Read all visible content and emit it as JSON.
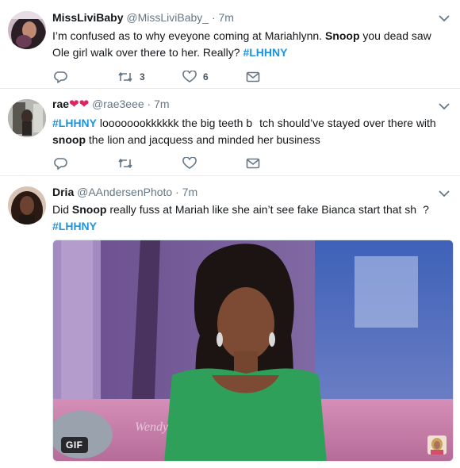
{
  "tweets": [
    {
      "name": "MissLiviBaby",
      "handle": "@MissLiviBaby_",
      "dot": "·",
      "time": "7m",
      "text_parts": [
        "I’m confused as to why eveyone coming at Mariahlynn. ",
        "Snoop",
        " you dead saw Ole girl walk over there to her. Really? ",
        "#LHHNY"
      ],
      "reply_count": "",
      "retweet_count": "3",
      "like_count": "6"
    },
    {
      "name": "rae",
      "hearts": "❤❤",
      "handle": "@rae3eee",
      "dot": "·",
      "time": "7m",
      "text_parts": [
        "#LHHNY",
        " loooooookkkkkk the big teeth b",
        "tch should’ve stayed over there with ",
        "snoop",
        " the lion and jacquess and minded her business"
      ],
      "retweet_count": "",
      "like_count": ""
    },
    {
      "name": "Dria",
      "handle": "@AAndersenPhoto",
      "dot": "·",
      "time": "7m",
      "text_parts": [
        "Did ",
        "Snoop",
        " really fuss at Mariah like she ain’t see fake Bianca start that sh",
        "?",
        "#LHHNY"
      ],
      "media": {
        "badge": "GIF",
        "watermark": "Wendy"
      }
    }
  ],
  "icons": {
    "reply": "reply-icon",
    "retweet": "retweet-icon",
    "like": "heart-icon",
    "dm": "envelope-icon",
    "caret": "chevron-down-icon"
  },
  "colors": {
    "hashtag": "#1b95e0",
    "muted": "#657786",
    "heart_red": "#e0245e"
  }
}
